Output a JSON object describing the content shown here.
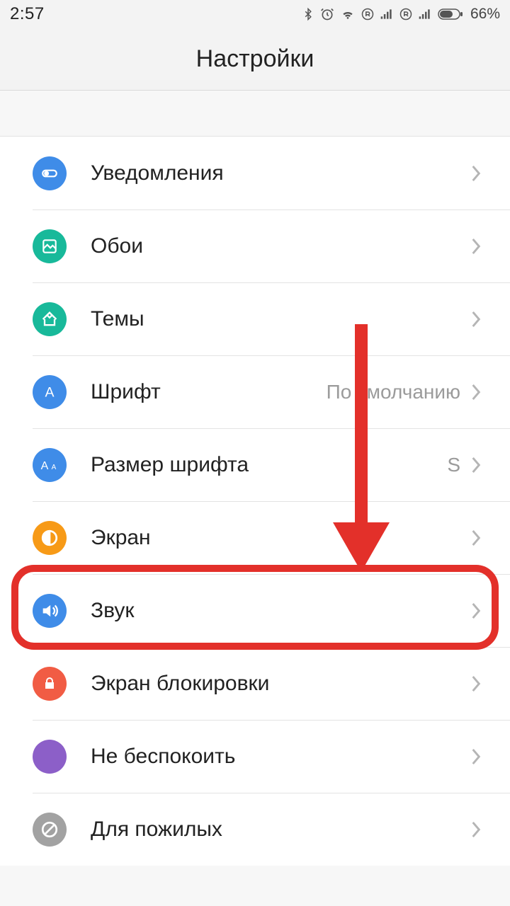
{
  "status": {
    "time": "2:57",
    "battery_pct": "66%"
  },
  "header": {
    "title": "Настройки"
  },
  "rows": [
    {
      "label": "Уведомления",
      "value": ""
    },
    {
      "label": "Обои",
      "value": ""
    },
    {
      "label": "Темы",
      "value": ""
    },
    {
      "label": "Шрифт",
      "value": "По умолчанию"
    },
    {
      "label": "Размер шрифта",
      "value": "S"
    },
    {
      "label": "Экран",
      "value": ""
    },
    {
      "label": "Звук",
      "value": ""
    },
    {
      "label": "Экран блокировки",
      "value": ""
    },
    {
      "label": "Не беспокоить",
      "value": ""
    },
    {
      "label": "Для пожилых",
      "value": ""
    }
  ],
  "annotation": {
    "highlight_row": 6
  }
}
